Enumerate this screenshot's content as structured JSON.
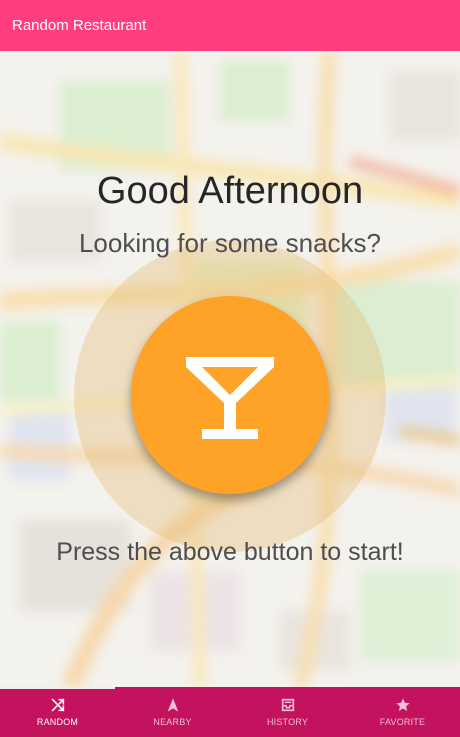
{
  "appbar": {
    "title": "Random Restaurant"
  },
  "main": {
    "greeting": "Good Afternoon",
    "subtitle": "Looking for some snacks?",
    "hint": "Press the above button to start!",
    "button_icon": "cocktail-glass-icon"
  },
  "bottom_nav": {
    "items": [
      {
        "label": "RANDOM",
        "icon": "shuffle-icon",
        "active": true
      },
      {
        "label": "NEARBY",
        "icon": "navigation-arrow-icon",
        "active": false
      },
      {
        "label": "HISTORY",
        "icon": "inbox-icon",
        "active": false
      },
      {
        "label": "FAVORITE",
        "icon": "star-icon",
        "active": false
      }
    ]
  },
  "colors": {
    "appbar": "#ff3d7f",
    "bottom_nav": "#c4135e",
    "button": "#ffa228"
  }
}
